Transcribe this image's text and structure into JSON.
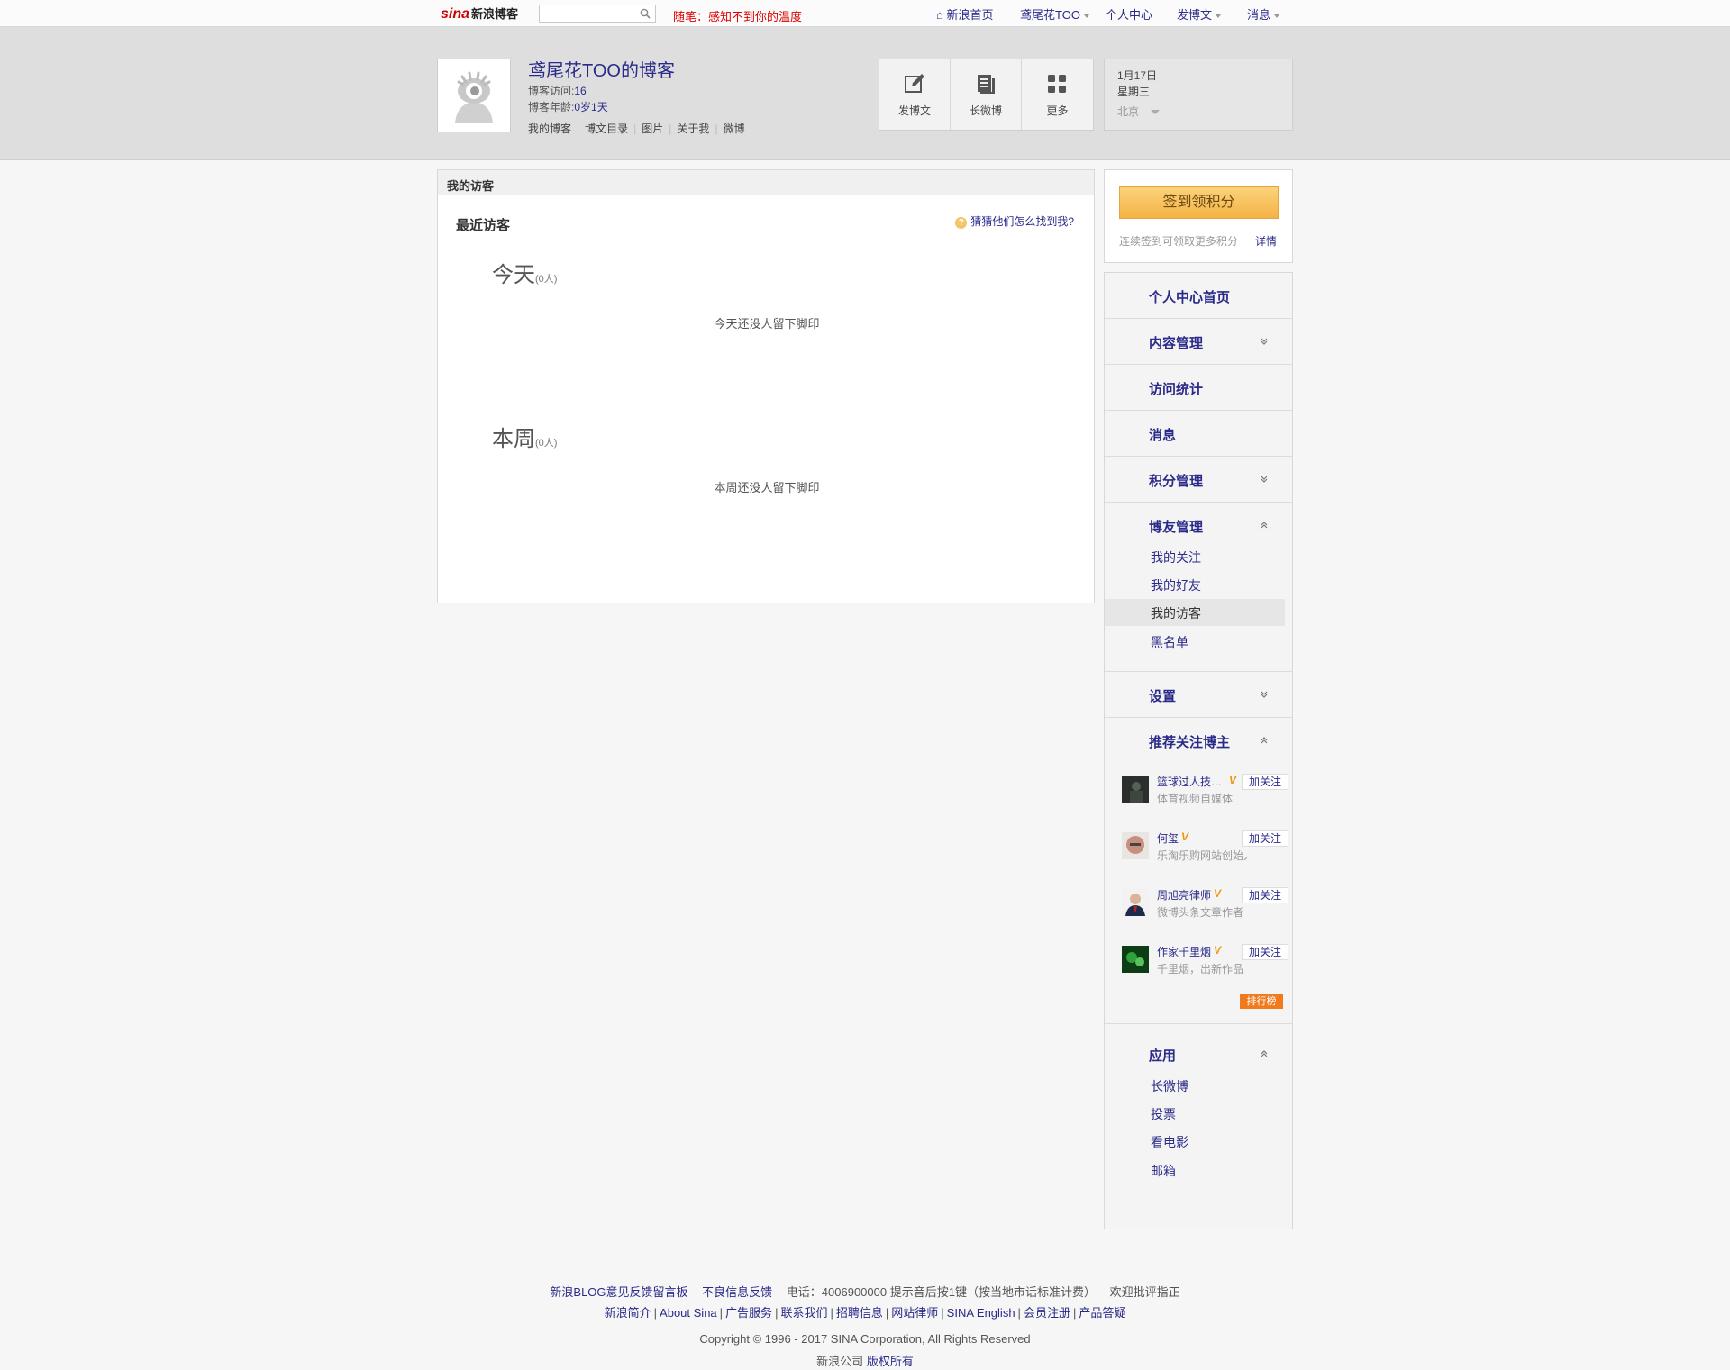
{
  "topbar": {
    "logo_sina": "sina",
    "logo_name": "新浪博客",
    "search_placeholder": "",
    "notice": "随笔：感知不到你的温度",
    "home": "新浪首页",
    "user": "鸢尾花TOO",
    "center": "个人中心",
    "post": "发博文",
    "messages": "消息"
  },
  "header": {
    "title": "鸢尾花TOO的博客",
    "visits_label": "博客访问:",
    "visits": "16",
    "age_label": "博客年龄:",
    "age": "0岁1天",
    "nav": [
      "我的博客",
      "博文目录",
      "图片",
      "关于我",
      "微博"
    ],
    "tools": [
      {
        "label": "发博文",
        "icon": "edit-icon"
      },
      {
        "label": "长微博",
        "icon": "long-weibo-icon"
      },
      {
        "label": "更多",
        "icon": "grid-icon"
      }
    ],
    "date": "1月17日",
    "weekday": "星期三",
    "city": "北京"
  },
  "main": {
    "header": "我的访客",
    "recent_title": "最近访客",
    "guess_link": "猜猜他们怎么找到我?",
    "today_title": "今天",
    "today_count": "(0人)",
    "today_empty": "今天还没人留下脚印",
    "week_title": "本周",
    "week_count": "(0人)",
    "week_empty": "本周还没人留下脚印"
  },
  "signin": {
    "button": "签到领积分",
    "note": "连续签到可领取更多积分",
    "detail": "详情"
  },
  "menu": {
    "home": "个人中心首页",
    "content": "内容管理",
    "stats": "访问统计",
    "message": "消息",
    "points": "积分管理",
    "friends": {
      "title": "博友管理",
      "items": [
        "我的关注",
        "我的好友",
        "我的访客",
        "黑名单"
      ]
    },
    "settings": "设置",
    "recommend": {
      "title": "推荐关注博主",
      "items": [
        {
          "name": "篮球过人技…",
          "desc": "体育视频自媒体",
          "follow": "加关注"
        },
        {
          "name": "何玺",
          "desc": "乐淘乐购网站创始人…",
          "follow": "加关注"
        },
        {
          "name": "周旭亮律师",
          "desc": "微博头条文章作者",
          "follow": "加关注"
        },
        {
          "name": "作家千里烟",
          "desc": "千里烟，出新作品《…",
          "follow": "加关注"
        }
      ],
      "rank": "排行榜",
      "verified_mark": "V"
    },
    "apps": {
      "title": "应用",
      "items": [
        "长微博",
        "投票",
        "看电影",
        "邮箱"
      ]
    }
  },
  "footer": {
    "line1": [
      "新浪BLOG意见反馈留言板",
      "不良信息反馈"
    ],
    "line1_phone": "电话：4006900000 提示音后按1键（按当地市话标准计费）",
    "line1_end": "欢迎批评指正",
    "line2": [
      "新浪简介",
      "About Sina",
      "广告服务",
      "联系我们",
      "招聘信息",
      "网站律师",
      "SINA English",
      "会员注册",
      "产品答疑"
    ],
    "copyright": "Copyright © 1996 - 2017 SINA Corporation, All Rights Reserved",
    "company": "新浪公司",
    "rights": "版权所有"
  }
}
